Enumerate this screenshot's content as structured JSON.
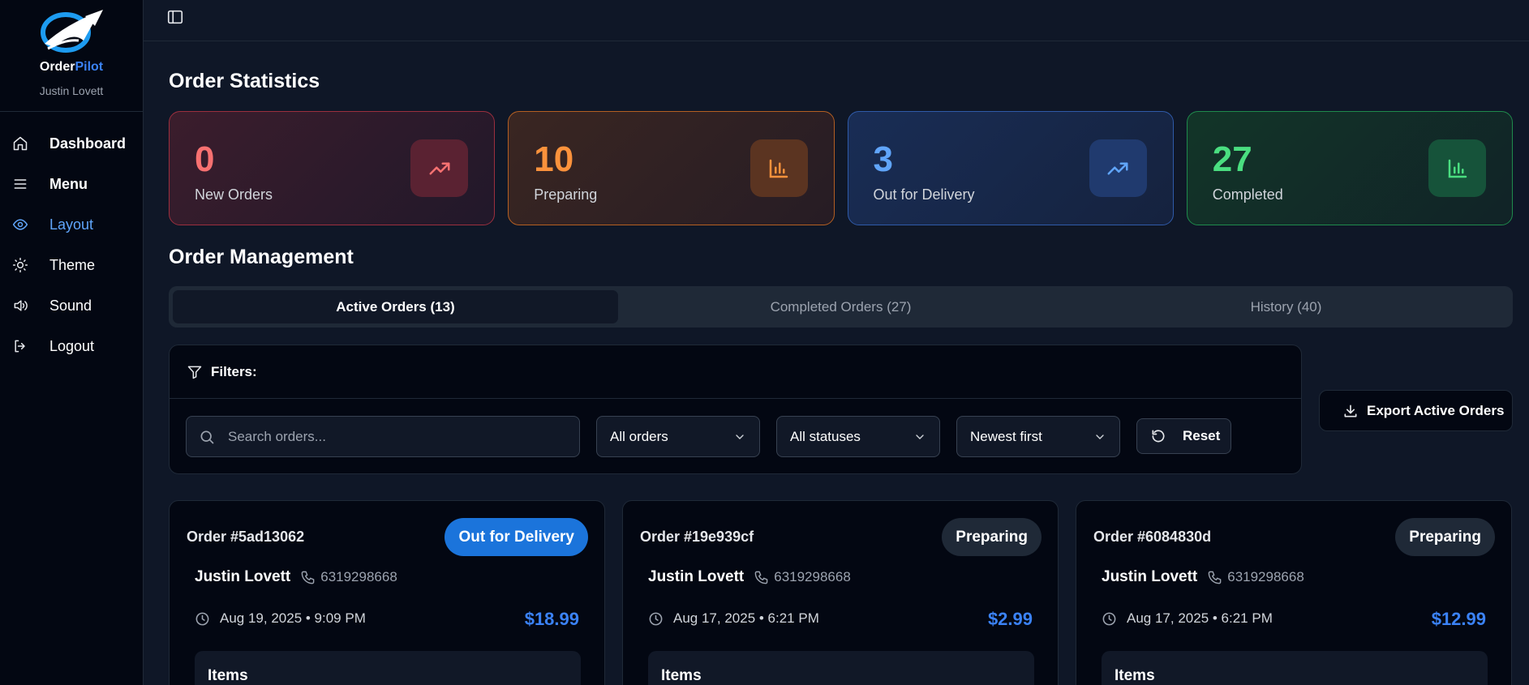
{
  "brand": {
    "name_part1": "Order",
    "name_part2": "Pilot",
    "user": "Justin Lovett"
  },
  "nav": [
    {
      "label": "Dashboard",
      "icon": "home-icon",
      "bold": true,
      "active": false
    },
    {
      "label": "Menu",
      "icon": "menu-icon",
      "bold": true,
      "active": false
    },
    {
      "label": "Layout",
      "icon": "eye-icon",
      "bold": false,
      "active": true
    },
    {
      "label": "Theme",
      "icon": "sun-icon",
      "bold": false,
      "active": false
    },
    {
      "label": "Sound",
      "icon": "volume-icon",
      "bold": false,
      "active": false
    },
    {
      "label": "Logout",
      "icon": "logout-icon",
      "bold": false,
      "active": false
    }
  ],
  "stats_title": "Order Statistics",
  "stats": [
    {
      "value": "0",
      "label": "New Orders",
      "color": "#f87171",
      "icon": "trending-up-icon"
    },
    {
      "value": "10",
      "label": "Preparing",
      "color": "#fb923c",
      "icon": "bar-chart-icon"
    },
    {
      "value": "3",
      "label": "Out for Delivery",
      "color": "#60a5fa",
      "icon": "trending-up-icon"
    },
    {
      "value": "27",
      "label": "Completed",
      "color": "#4ade80",
      "icon": "bar-chart-icon"
    }
  ],
  "management_title": "Order Management",
  "tabs": [
    {
      "label": "Active Orders (13)",
      "active": true
    },
    {
      "label": "Completed Orders (27)",
      "active": false
    },
    {
      "label": "History (40)",
      "active": false
    }
  ],
  "filters": {
    "title": "Filters:",
    "search_placeholder": "Search orders...",
    "type_value": "All orders",
    "status_value": "All statuses",
    "sort_value": "Newest first",
    "reset_label": "Reset"
  },
  "export_label": "Export Active Orders",
  "orders": [
    {
      "id": "Order #5ad13062",
      "status": "Out for Delivery",
      "customer": "Justin Lovett",
      "phone": "6319298668",
      "time": "Aug 19, 2025 • 9:09 PM",
      "total": "$18.99",
      "items_label": "Items"
    },
    {
      "id": "Order #19e939cf",
      "status": "Preparing",
      "customer": "Justin Lovett",
      "phone": "6319298668",
      "time": "Aug 17, 2025 • 6:21 PM",
      "total": "$2.99",
      "items_label": "Items"
    },
    {
      "id": "Order #6084830d",
      "status": "Preparing",
      "customer": "Justin Lovett",
      "phone": "6319298668",
      "time": "Aug 17, 2025 • 6:21 PM",
      "total": "$12.99",
      "items_label": "Items"
    }
  ]
}
